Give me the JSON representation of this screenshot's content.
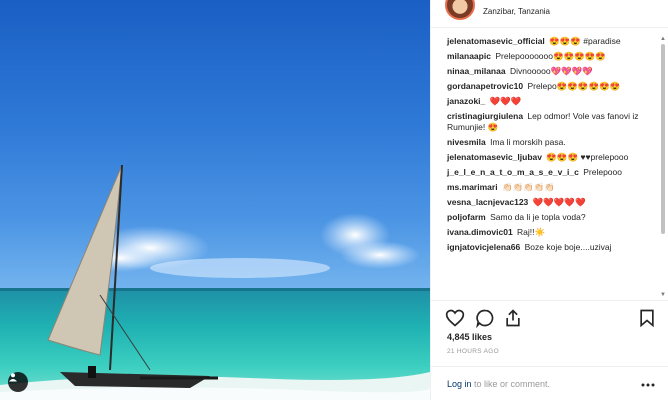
{
  "header": {
    "location": "Zanzibar, Tanzania"
  },
  "comments": [
    {
      "user": "jelenatomasevic_official",
      "text": "😍😍😍 #paradise"
    },
    {
      "user": "milanaapic",
      "text": "Prelepooooooo😍😍😍😍😍"
    },
    {
      "user": "ninaa_milanaa",
      "text": "Divnooooo💖💖💖💖"
    },
    {
      "user": "gordanapetrovic10",
      "text": "Prelepo😍😍😍😍😍😍"
    },
    {
      "user": "janazoki_",
      "text": "❤️❤️❤️"
    },
    {
      "user": "cristinagiurgiulena",
      "text": "Lep odmor! Vole vas fanovi iz Rumunjie! 😍"
    },
    {
      "user": "nivesmila",
      "text": "Ima li morskih pasa."
    },
    {
      "user": "jelenatomasevic_ljubav",
      "text": "😍😍😍 ♥♥prelepooo"
    },
    {
      "user": "j_e_l_e_n_a_t_o_m_a_s_e_v_i_c",
      "text": "Prelepooo"
    },
    {
      "user": "ms.marimari",
      "text": "👏🏻👏🏻👏🏻👏🏻👏🏻"
    },
    {
      "user": "vesna_lacnjevac123",
      "text": "❤️❤️❤️❤️❤️"
    },
    {
      "user": "poljofarm",
      "text": "Samo da li je topla voda?"
    },
    {
      "user": "ivana.dimovic01",
      "text": "Raj!!☀️"
    },
    {
      "user": "ignjatovicjelena66",
      "text": "Boze koje boje....uzivaj"
    }
  ],
  "post": {
    "likes": "4,845 likes",
    "time_ago": "21 HOURS AGO"
  },
  "footer": {
    "login_link": "Log in",
    "login_rest": " to like or comment."
  },
  "icons": {
    "like": "heart-icon",
    "comment": "comment-icon",
    "share": "share-icon",
    "save": "bookmark-icon",
    "more": "more-icon",
    "tag": "user-tag-icon"
  },
  "colors": {
    "link": "#003569",
    "muted": "#999999",
    "text": "#262626"
  }
}
